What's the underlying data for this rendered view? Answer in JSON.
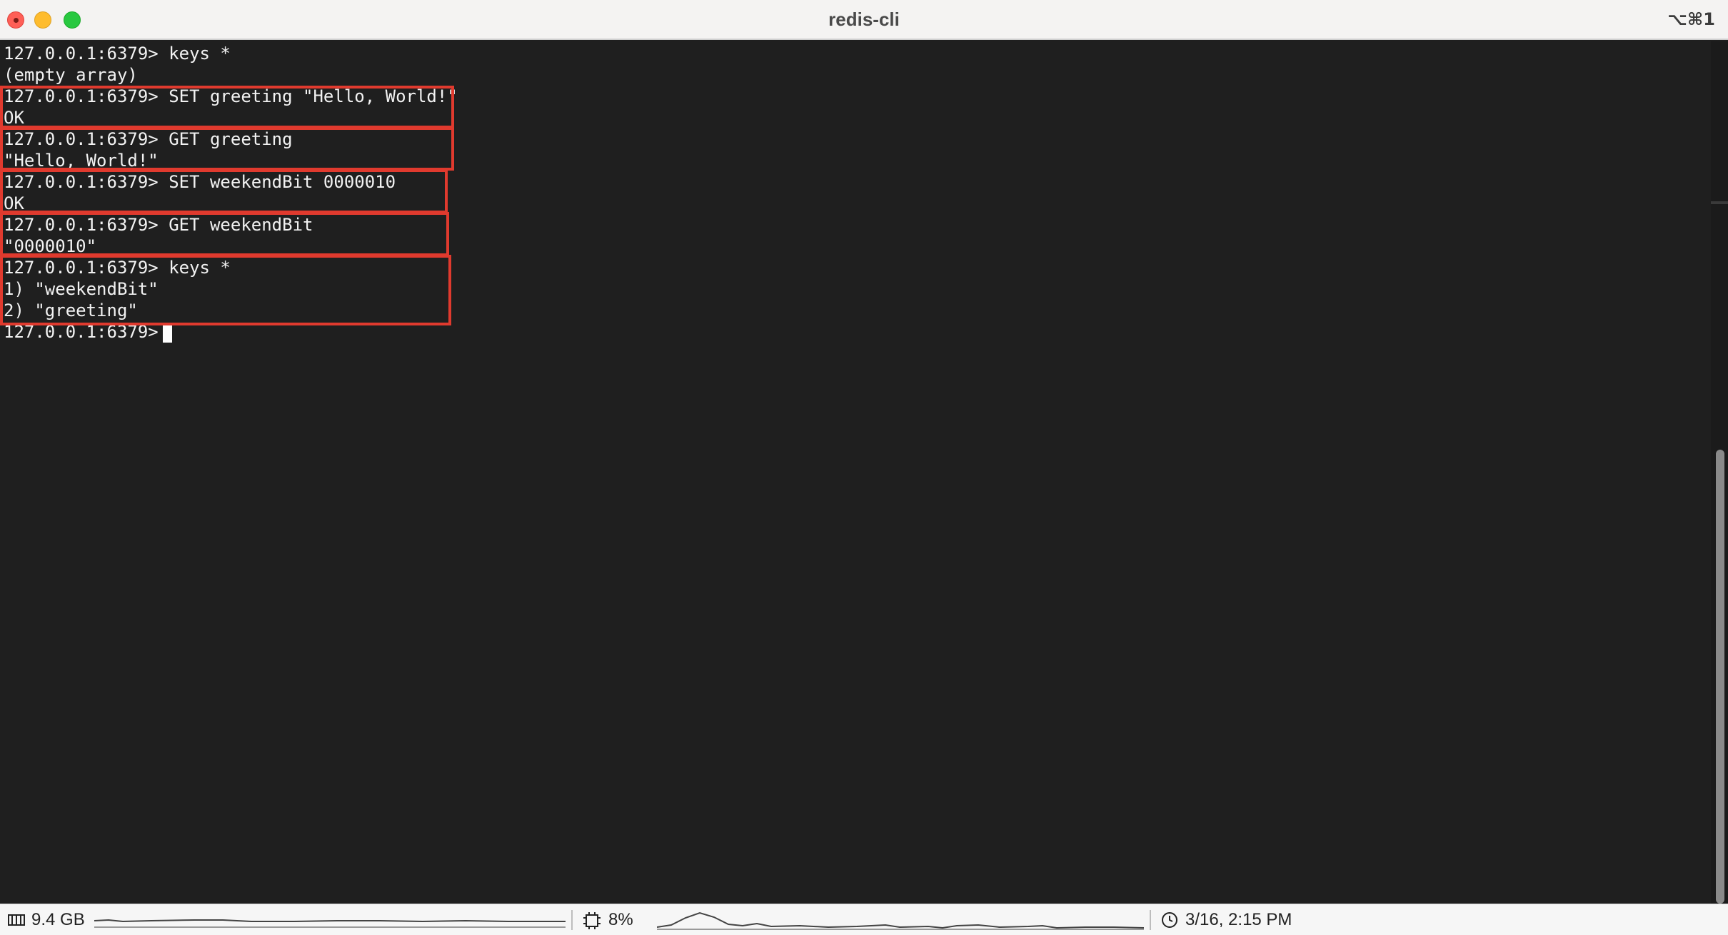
{
  "window": {
    "title": "redis-cli",
    "shortcut": "⌥⌘1"
  },
  "terminal": {
    "lines": [
      "127.0.0.1:6379> keys *",
      "(empty array)",
      "127.0.0.1:6379> SET greeting \"Hello, World!\"",
      "OK",
      "127.0.0.1:6379> GET greeting",
      "\"Hello, World!\"",
      "127.0.0.1:6379> SET weekendBit 0000010",
      "OK",
      "127.0.0.1:6379> GET weekendBit",
      "\"0000010\"",
      "127.0.0.1:6379> keys *",
      "1) \"weekendBit\"",
      "2) \"greeting\"",
      "127.0.0.1:6379> "
    ]
  },
  "statusbar": {
    "memory": "9.4 GB",
    "cpu": "8%",
    "datetime": "3/16, 2:15 PM"
  },
  "colors": {
    "terminal_bg": "#1f1f1f",
    "terminal_fg": "#f2f2f2",
    "highlight": "#e03a2e"
  }
}
